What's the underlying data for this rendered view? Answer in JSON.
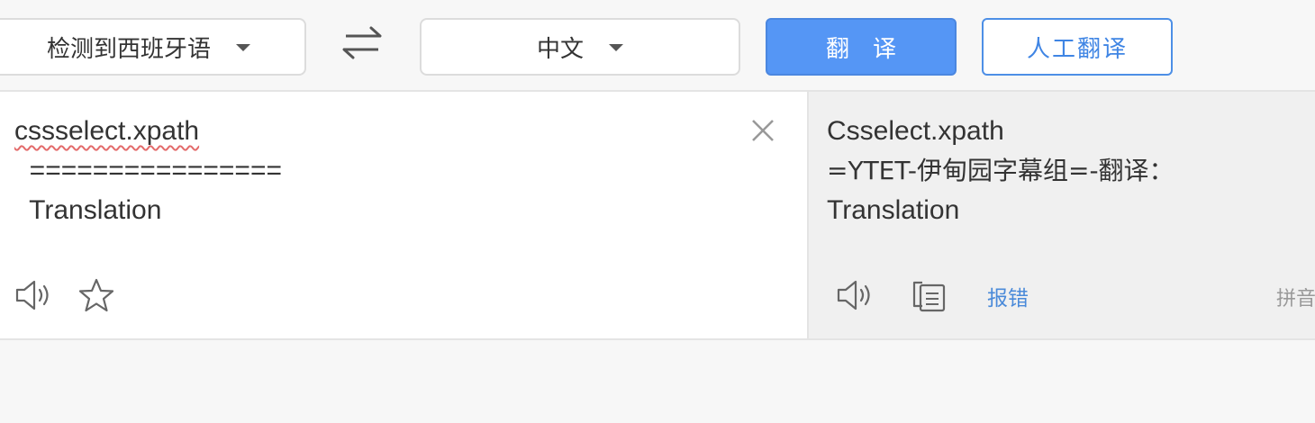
{
  "toolbar": {
    "source_language": "检测到西班牙语",
    "target_language": "中文",
    "translate_label": "翻译",
    "human_translate_label": "人工翻译"
  },
  "source": {
    "lines": [
      "cssselect.xpath",
      "  ================",
      "  Translation"
    ]
  },
  "result": {
    "lines": [
      "Csselect.xpath",
      "=YTET-伊甸园字幕组=-翻译：",
      "Translation"
    ],
    "report_error_label": "报错",
    "pinyin_label": "拼音"
  },
  "icons": {
    "swap": "swap-arrows-icon",
    "caret": "caret-down-icon",
    "clear": "close-icon",
    "speaker": "speaker-icon",
    "star": "star-icon",
    "copy": "copy-icon"
  },
  "colors": {
    "primary": "#5596f5",
    "link": "#4a8ad9",
    "spellcheck_underline": "#e36b6b",
    "result_background": "#f0f0f0"
  }
}
